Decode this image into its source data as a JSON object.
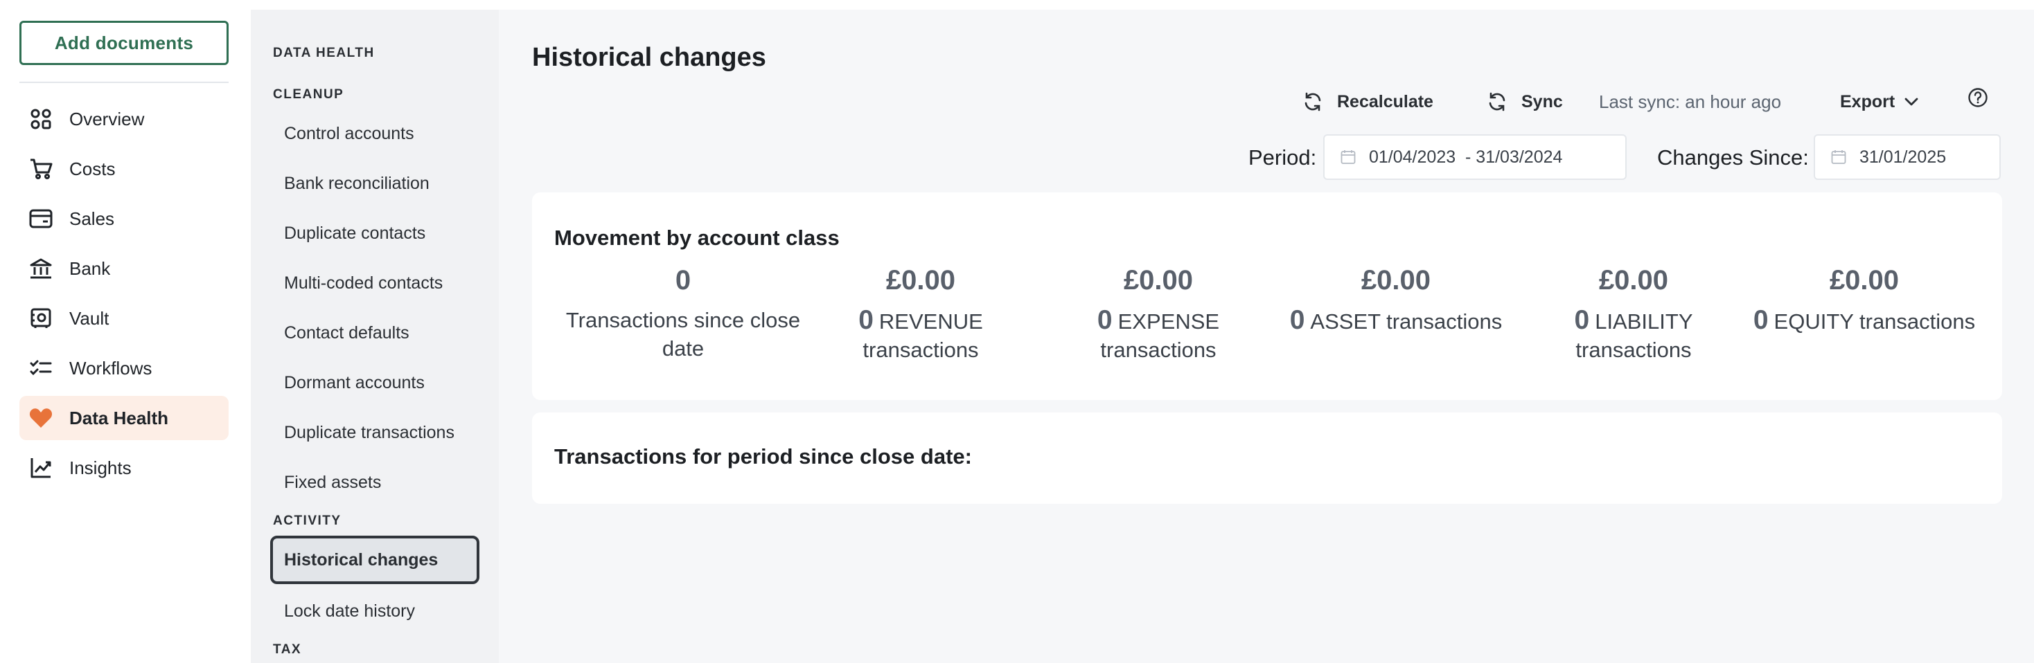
{
  "leftnav": {
    "add_documents": "Add documents",
    "items": [
      {
        "label": "Overview",
        "icon": "overview-icon"
      },
      {
        "label": "Costs",
        "icon": "cart-icon"
      },
      {
        "label": "Sales",
        "icon": "card-icon"
      },
      {
        "label": "Bank",
        "icon": "bank-icon"
      },
      {
        "label": "Vault",
        "icon": "vault-icon"
      },
      {
        "label": "Workflows",
        "icon": "checklist-icon"
      },
      {
        "label": "Data Health",
        "icon": "heart-icon",
        "active": true
      },
      {
        "label": "Insights",
        "icon": "chart-icon"
      }
    ],
    "accent": "#e8733a",
    "brand": "#2f6f53"
  },
  "subnav": {
    "heading": "DATA HEALTH",
    "cleanup_heading": "CLEANUP",
    "cleanup_items": [
      "Control accounts",
      "Bank reconciliation",
      "Duplicate contacts",
      "Multi-coded contacts",
      "Contact defaults",
      "Dormant accounts",
      "Duplicate transactions",
      "Fixed assets"
    ],
    "activity_heading": "ACTIVITY",
    "activity_items": [
      "Historical changes",
      "Lock date history"
    ],
    "tax_heading": "TAX"
  },
  "main": {
    "title": "Historical changes",
    "toolbar": {
      "recalculate": "Recalculate",
      "sync": "Sync",
      "last_sync": "Last sync: an hour ago",
      "export": "Export"
    },
    "period_label": "Period:",
    "period_value": "01/04/2023  - 31/03/2024",
    "changes_since_label": "Changes Since:",
    "changes_since_value": "31/01/2025",
    "movement_card": {
      "title": "Movement by account class",
      "stats": [
        {
          "value": "0",
          "count": "",
          "desc": "Transactions since close date"
        },
        {
          "value": "£0.00",
          "count": "0",
          "desc": "REVENUE transactions"
        },
        {
          "value": "£0.00",
          "count": "0",
          "desc": "EXPENSE transactions"
        },
        {
          "value": "£0.00",
          "count": "0",
          "desc": "ASSET transactions"
        },
        {
          "value": "£0.00",
          "count": "0",
          "desc": "LIABILITY transactions"
        },
        {
          "value": "£0.00",
          "count": "0",
          "desc": "EQUITY transactions"
        }
      ]
    },
    "transactions_card": {
      "title": "Transactions for period since close date:"
    }
  }
}
